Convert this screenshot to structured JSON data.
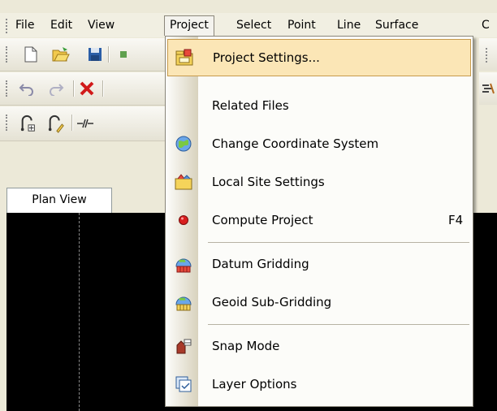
{
  "menubar": {
    "items": [
      "File",
      "Edit",
      "View",
      "Project",
      "Select",
      "Point",
      "Line",
      "Surface",
      "C"
    ],
    "open_index": 3
  },
  "tabs": {
    "plan_view": "Plan View"
  },
  "project_menu": {
    "items": [
      {
        "label": "Project Settings...",
        "icon": "project-settings-icon",
        "highlighted": true
      },
      {
        "label": "Related Files",
        "icon": ""
      },
      {
        "label": "Change Coordinate System",
        "icon": "globe-icon"
      },
      {
        "label": "Local Site Settings",
        "icon": "local-site-icon"
      },
      {
        "label": "Compute Project",
        "icon": "compute-dot-icon",
        "shortcut": "F4"
      },
      {
        "label": "Datum Gridding",
        "icon": "datum-grid-icon"
      },
      {
        "label": "Geoid Sub-Gridding",
        "icon": "geoid-grid-icon"
      },
      {
        "label": "Snap Mode",
        "icon": "snap-mode-icon"
      },
      {
        "label": "Layer Options",
        "icon": "layer-options-icon"
      }
    ]
  },
  "colors": {
    "menu_highlight": "#fbe6b6",
    "menu_highlight_border": "#c69a4d",
    "canvas": "#000000",
    "delete_red": "#d11a1a"
  }
}
